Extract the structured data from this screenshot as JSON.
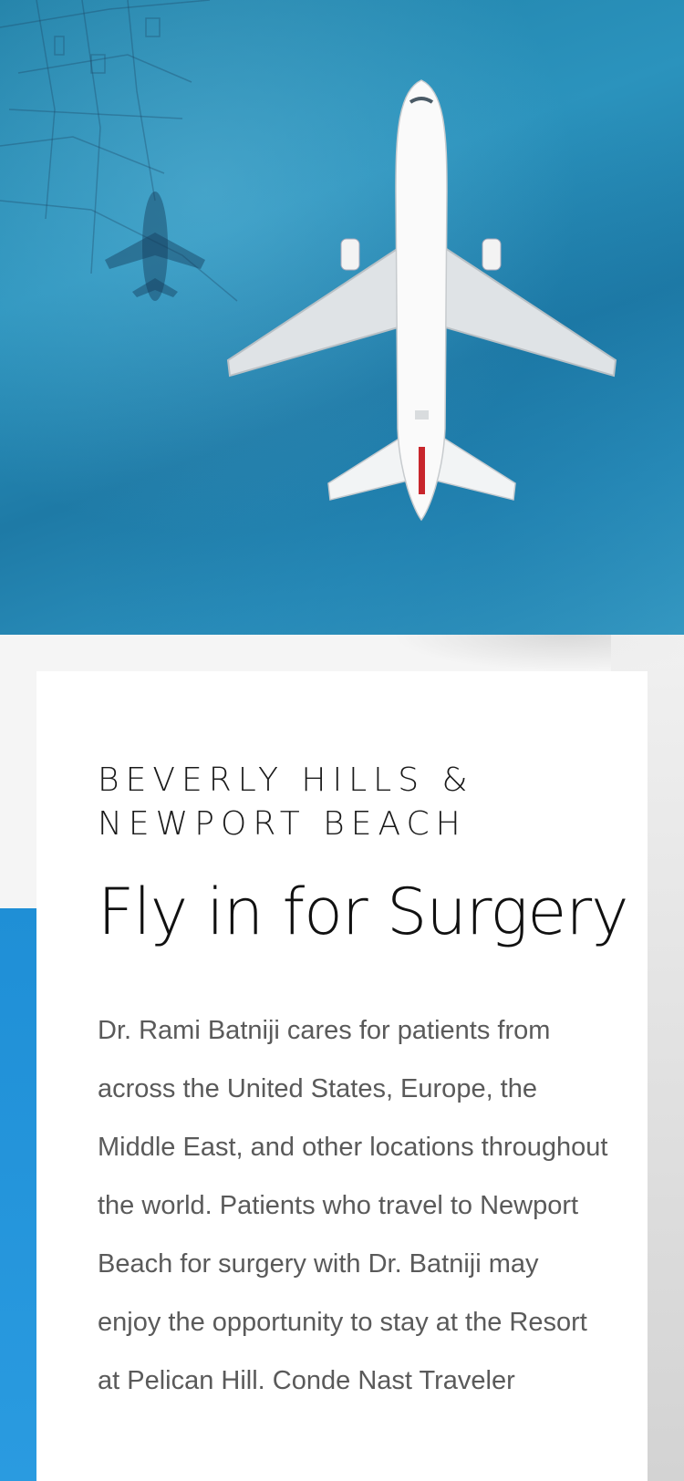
{
  "hero": {
    "image_label": "airplane-over-ocean"
  },
  "card": {
    "kicker_line1": "BEVERLY HILLS &",
    "kicker_line2": "NEWPORT BEACH",
    "headline": "Fly in for Surgery",
    "body": "Dr. Rami Batniji cares for patients from across the United States, Europe, the Middle East, and other locations throughout the world. Patients who travel to Newport Beach for surgery with Dr. Batniji may enjoy the opportunity to stay at the Resort at Pelican Hill. Conde Nast Traveler"
  },
  "colors": {
    "accent": "#1f8fd6",
    "ocean": "#2b93bd",
    "heading": "#111111",
    "body": "#5a5a5a"
  }
}
